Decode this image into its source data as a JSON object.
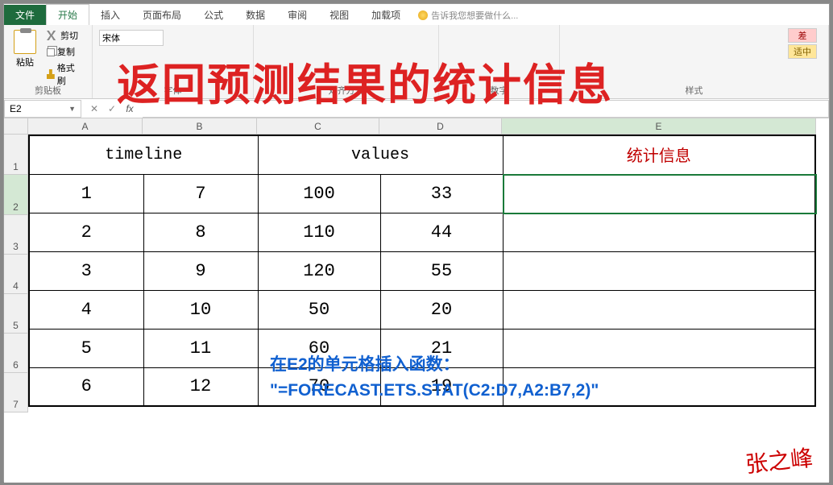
{
  "tabs": {
    "file": "文件",
    "home": "开始",
    "insert": "插入",
    "layout": "页面布局",
    "formulas": "公式",
    "data": "数据",
    "review": "审阅",
    "view": "视图",
    "addins": "加载项",
    "tellme": "告诉我您想要做什么..."
  },
  "ribbon": {
    "paste": "粘贴",
    "cut": "剪切",
    "copy": "复制",
    "format_painter": "格式刷",
    "clipboard": "剪贴板",
    "font_name": "宋体",
    "font": "字体",
    "alignment": "对齐方式",
    "number": "数字",
    "styles": "样式",
    "bad": "差",
    "good": "适中"
  },
  "namebox": "E2",
  "columns": {
    "a": "A",
    "b": "B",
    "c": "C",
    "d": "D",
    "e": "E"
  },
  "row_nums": {
    "r1": "1",
    "r2": "2",
    "r3": "3",
    "r4": "4",
    "r5": "5",
    "r6": "6",
    "r7": "7"
  },
  "headers": {
    "timeline": "timeline",
    "values": "values",
    "stat": "统计信息"
  },
  "data": {
    "r2": {
      "a": "1",
      "b": "7",
      "c": "100",
      "d": "33"
    },
    "r3": {
      "a": "2",
      "b": "8",
      "c": "110",
      "d": "44"
    },
    "r4": {
      "a": "3",
      "b": "9",
      "c": "120",
      "d": "55"
    },
    "r5": {
      "a": "4",
      "b": "10",
      "c": "50",
      "d": "20"
    },
    "r6": {
      "a": "5",
      "b": "11",
      "c": "60",
      "d": "21"
    },
    "r7": {
      "a": "6",
      "b": "12",
      "c": "70",
      "d": "19"
    }
  },
  "overlay": {
    "title": "返回预测结果的统计信息",
    "inst1": "在E2的单元格插入函数：",
    "inst2": "\"=FORECAST.ETS.STAT(C2:D7,A2:B7,2)\"",
    "sig": "张之峰"
  }
}
